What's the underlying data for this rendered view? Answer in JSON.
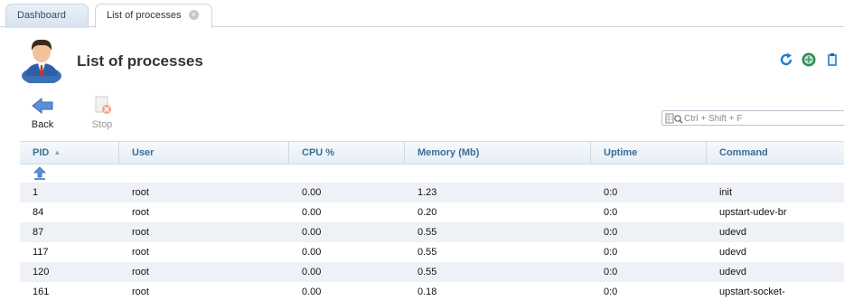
{
  "tabs": [
    {
      "label": "Dashboard",
      "active": false
    },
    {
      "label": "List of processes",
      "active": true
    }
  ],
  "header": {
    "title": "List of processes",
    "icons": [
      "refresh-icon",
      "web-icon",
      "clipboard-icon"
    ]
  },
  "toolbar": {
    "back_label": "Back",
    "stop_label": "Stop"
  },
  "search": {
    "placeholder": "Ctrl + Shift + F"
  },
  "table": {
    "columns": [
      "PID",
      "User",
      "CPU %",
      "Memory (Mb)",
      "Uptime",
      "Command"
    ],
    "sort_column": "PID",
    "sort_direction": "asc",
    "rows": [
      {
        "pid": "1",
        "user": "root",
        "cpu": "0.00",
        "memory": "1.23",
        "uptime": "0:0",
        "command": "init"
      },
      {
        "pid": "84",
        "user": "root",
        "cpu": "0.00",
        "memory": "0.20",
        "uptime": "0:0",
        "command": "upstart-udev-br"
      },
      {
        "pid": "87",
        "user": "root",
        "cpu": "0.00",
        "memory": "0.55",
        "uptime": "0:0",
        "command": "udevd"
      },
      {
        "pid": "117",
        "user": "root",
        "cpu": "0.00",
        "memory": "0.55",
        "uptime": "0:0",
        "command": "udevd"
      },
      {
        "pid": "120",
        "user": "root",
        "cpu": "0.00",
        "memory": "0.55",
        "uptime": "0:0",
        "command": "udevd"
      },
      {
        "pid": "161",
        "user": "root",
        "cpu": "0.00",
        "memory": "0.18",
        "uptime": "0:0",
        "command": "upstart-socket-"
      }
    ]
  },
  "colors": {
    "header_text": "#3d6d94",
    "row_alt": "#eef2f7",
    "refresh": "#1b7fd1"
  }
}
